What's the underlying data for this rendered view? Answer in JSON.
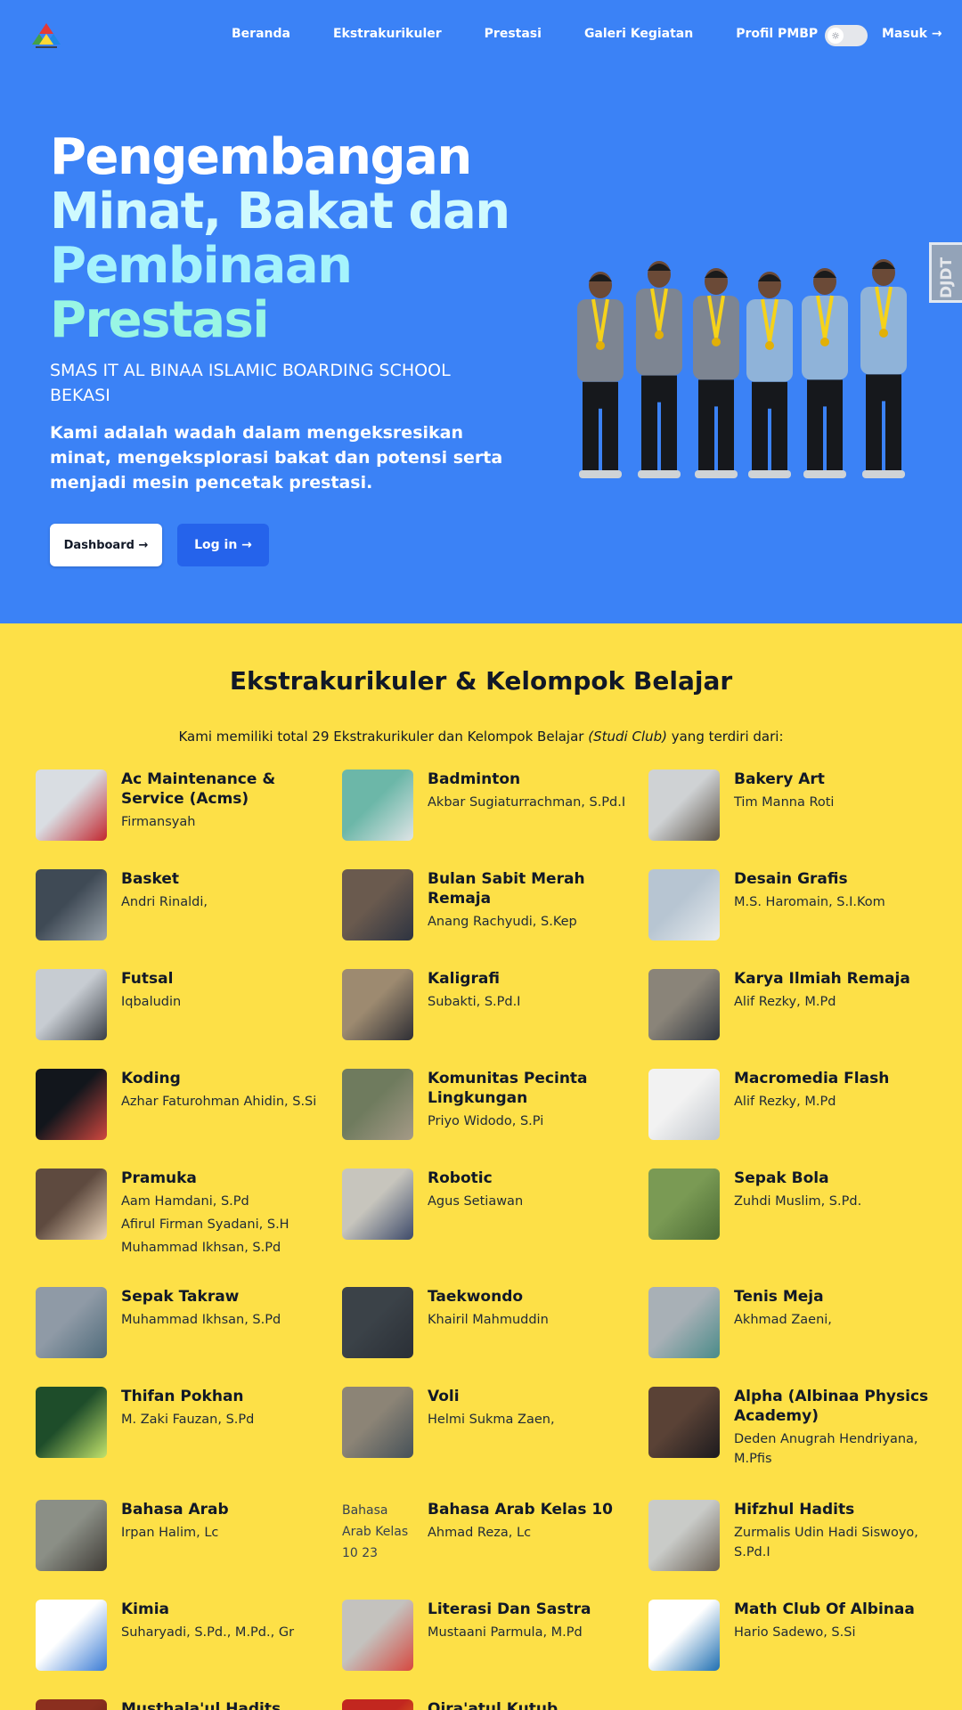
{
  "nav": {
    "links": [
      "Beranda",
      "Ekstrakurikuler",
      "Prestasi",
      "Galeri Kegiatan",
      "Profil PMBP"
    ],
    "login_label": "Masuk →",
    "theme_toggle_icon": "sun-icon"
  },
  "hero": {
    "headline": [
      "Pengembangan",
      "Minat, Bakat dan",
      "Pembinaan",
      "Prestasi"
    ],
    "school": "SMAS IT AL BINAA ISLAMIC BOARDING SCHOOL BEKASI",
    "description": "Kami adalah wadah dalam mengeksresikan minat, mengeksplorasi bakat dan potensi serta menjadi mesin pencetak prestasi.",
    "dashboard_label": "Dashboard →",
    "login_label": "Log in →",
    "side_tab_label": "DJDT"
  },
  "section": {
    "title": "Ekstrakurikuler & Kelompok Belajar",
    "subtitle_pre": "Kami memiliki total 29 Ekstrakurikuler dan Kelompok Belajar ",
    "subtitle_em": "(Studi Club)",
    "subtitle_post": " yang terdiri dari:"
  },
  "clubs": [
    {
      "name": "Ac Maintenance & Service (Acms)",
      "coaches": [
        "Firmansyah"
      ]
    },
    {
      "name": "Badminton",
      "coaches": [
        "Akbar Sugiaturrachman, S.Pd.I"
      ]
    },
    {
      "name": "Bakery Art",
      "coaches": [
        "Tim Manna Roti"
      ]
    },
    {
      "name": "Basket",
      "coaches": [
        "Andri Rinaldi,"
      ]
    },
    {
      "name": "Bulan Sabit Merah Remaja",
      "coaches": [
        "Anang Rachyudi, S.Kep"
      ]
    },
    {
      "name": "Desain Grafis",
      "coaches": [
        "M.S. Haromain, S.I.Kom"
      ]
    },
    {
      "name": "Futsal",
      "coaches": [
        "Iqbaludin"
      ]
    },
    {
      "name": "Kaligrafi",
      "coaches": [
        "Subakti, S.Pd.I"
      ]
    },
    {
      "name": "Karya Ilmiah Remaja",
      "coaches": [
        "Alif Rezky, M.Pd"
      ]
    },
    {
      "name": "Koding",
      "coaches": [
        "Azhar Faturohman Ahidin, S.Si"
      ]
    },
    {
      "name": "Komunitas Pecinta Lingkungan",
      "coaches": [
        "Priyo Widodo, S.Pi"
      ]
    },
    {
      "name": "Macromedia Flash",
      "coaches": [
        "Alif Rezky, M.Pd"
      ]
    },
    {
      "name": "Pramuka",
      "coaches": [
        "Aam Hamdani, S.Pd",
        "Afirul Firman Syadani, S.H",
        "Muhammad Ikhsan, S.Pd"
      ]
    },
    {
      "name": "Robotic",
      "coaches": [
        "Agus Setiawan"
      ]
    },
    {
      "name": "Sepak Bola",
      "coaches": [
        "Zuhdi Muslim, S.Pd."
      ]
    },
    {
      "name": "Sepak Takraw",
      "coaches": [
        "Muhammad Ikhsan, S.Pd"
      ]
    },
    {
      "name": "Taekwondo",
      "coaches": [
        "Khairil Mahmuddin"
      ]
    },
    {
      "name": "Tenis Meja",
      "coaches": [
        "Akhmad Zaeni,"
      ]
    },
    {
      "name": "Thifan Pokhan",
      "coaches": [
        "M. Zaki Fauzan, S.Pd"
      ]
    },
    {
      "name": "Voli",
      "coaches": [
        "Helmi Sukma Zaen,"
      ]
    },
    {
      "name": "Alpha (Albinaa Physics Academy)",
      "coaches": [
        "Deden Anugrah Hendriyana, M.Pfis"
      ]
    },
    {
      "name": "Bahasa Arab",
      "coaches": [
        "Irpan Halim, Lc"
      ]
    },
    {
      "name": "Bahasa Arab Kelas 10",
      "coaches": [
        "Ahmad Reza, Lc"
      ],
      "broken_image_alt": "Bahasa Arab Kelas 10 23"
    },
    {
      "name": "Hifzhul Hadits",
      "coaches": [
        "Zurmalis Udin Hadi Siswoyo, S.Pd.I"
      ]
    },
    {
      "name": "Kimia",
      "coaches": [
        "Suharyadi, S.Pd., M.Pd., Gr"
      ]
    },
    {
      "name": "Literasi Dan Sastra",
      "coaches": [
        "Mustaani Parmula, M.Pd"
      ]
    },
    {
      "name": "Math Club Of Albinaa",
      "coaches": [
        "Hario Sadewo, S.Si"
      ]
    },
    {
      "name": "Musthala'ul Hadits",
      "coaches": []
    },
    {
      "name": "Qira'atul Kutub",
      "coaches": []
    }
  ],
  "thumb_colors": [
    [
      "#d9dde2",
      "#c2262e"
    ],
    [
      "#6cb7a8",
      "#dfe4e6"
    ],
    [
      "#cfd2d4",
      "#5b5247"
    ],
    [
      "#3f4a55",
      "#9aa3ab"
    ],
    [
      "#6a5a4e",
      "#2d3340"
    ],
    [
      "#b7c5d2",
      "#e8ecef"
    ],
    [
      "#c7ccd2",
      "#3a3f46"
    ],
    [
      "#9d8a70",
      "#2e2e34"
    ],
    [
      "#8a8479",
      "#30363f"
    ],
    [
      "#12161c",
      "#d0473f"
    ],
    [
      "#6f7b5e",
      "#a59a87"
    ],
    [
      "#f2f2f2",
      "#bfc5cc"
    ],
    [
      "#5e4a3f",
      "#e9d3b8"
    ],
    [
      "#c7c5bd",
      "#3d4a6a"
    ],
    [
      "#7a9a54",
      "#4b6b35"
    ],
    [
      "#8f9aa6",
      "#4e6a7a"
    ],
    [
      "#3b4248",
      "#2a2f36"
    ],
    [
      "#a8b0b6",
      "#4a8b89"
    ],
    [
      "#1e4d2a",
      "#c2e36b"
    ],
    [
      "#8c8476",
      "#465158"
    ],
    [
      "#5a4236",
      "#1d1b1e"
    ],
    [
      "#8b8f86",
      "#3f3b36"
    ],
    [
      "#FDE047",
      "#FDE047"
    ],
    [
      "#c9cbc8",
      "#6a6055"
    ],
    [
      "#ffffff",
      "#3a7bd5"
    ],
    [
      "#c4c2be",
      "#d6483f"
    ],
    [
      "#ffffff",
      "#1f6fb2"
    ],
    [
      "#8b2f1f",
      "#5a1c10"
    ],
    [
      "#c2271f",
      "#f2a31a"
    ]
  ]
}
